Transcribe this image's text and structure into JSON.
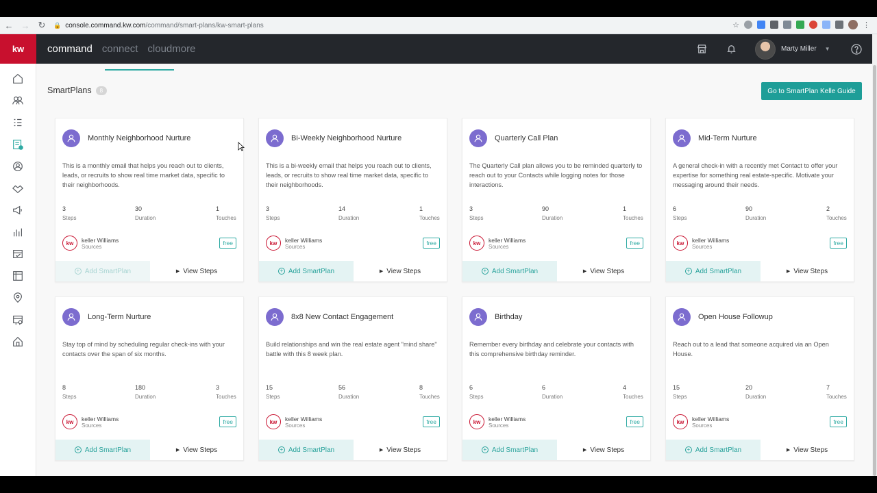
{
  "browser": {
    "url_host": "console.command.kw.com",
    "url_path": "/command/smart-plans/kw-smart-plans"
  },
  "header": {
    "logo": "kw",
    "nav": [
      "command",
      "connect",
      "cloudmore"
    ],
    "user_name": "Marty Miller"
  },
  "page": {
    "title": "SmartPlans",
    "count": "8",
    "guide_button": "Go to SmartPlan Kelle Guide"
  },
  "labels": {
    "steps": "Steps",
    "duration": "Duration",
    "touches": "Touches",
    "source_sub": "Sources",
    "free": "free",
    "add": "Add SmartPlan",
    "view": "View Steps"
  },
  "cards": [
    {
      "title": "Monthly Neighborhood Nurture",
      "desc": "This is a monthly email that helps you reach out to clients, leads, or recruits to show real time market data, specific to their neighborhoods.",
      "steps": "3",
      "duration": "30",
      "touches": "1",
      "source": "keller Williams",
      "add_disabled": true
    },
    {
      "title": "Bi-Weekly Neighborhood Nurture",
      "desc": "This is a bi-weekly email that helps you reach out to clients, leads, or recruits to show real time market data, specific to their neighborhoods.",
      "steps": "3",
      "duration": "14",
      "touches": "1",
      "source": "keller Williams",
      "add_disabled": false
    },
    {
      "title": "Quarterly Call Plan",
      "desc": "The Quarterly Call plan allows you to be reminded quarterly to reach out to your Contacts while logging notes for those interactions.",
      "steps": "3",
      "duration": "90",
      "touches": "1",
      "source": "keller Williams",
      "add_disabled": false
    },
    {
      "title": "Mid-Term Nurture",
      "desc": "A general check-in with a recently met Contact to offer your expertise for something real estate-specific. Motivate your messaging around their needs.",
      "steps": "6",
      "duration": "90",
      "touches": "2",
      "source": "keller Williams",
      "add_disabled": false
    },
    {
      "title": "Long-Term Nurture",
      "desc": "Stay top of mind by scheduling regular check-ins with your contacts over the span of six months.",
      "steps": "8",
      "duration": "180",
      "touches": "3",
      "source": "keller Williams",
      "add_disabled": false
    },
    {
      "title": "8x8 New Contact Engagement",
      "desc": "Build relationships and win the real estate agent \"mind share\" battle with this 8 week plan.",
      "steps": "15",
      "duration": "56",
      "touches": "8",
      "source": "keller Williams",
      "add_disabled": false
    },
    {
      "title": "Birthday",
      "desc": "Remember every birthday and celebrate your contacts with this comprehensive birthday reminder.",
      "steps": "6",
      "duration": "6",
      "touches": "4",
      "source": "keller Williams",
      "add_disabled": false
    },
    {
      "title": "Open House Followup",
      "desc": "Reach out to a lead that someone acquired via an Open House.",
      "steps": "15",
      "duration": "20",
      "touches": "7",
      "source": "keller Williams",
      "add_disabled": false
    }
  ],
  "sidebar_icons": [
    "home-icon",
    "contacts-icon",
    "tasks-icon",
    "smartplans-icon",
    "location-icon",
    "handshake-icon",
    "megaphone-icon",
    "reports-icon",
    "marketing-icon",
    "listings-icon",
    "map-pin-icon",
    "calendar-icon",
    "house-icon"
  ],
  "colors": {
    "brand_red": "#c8102e",
    "teal": "#1e9e98",
    "purple": "#7c6ccf",
    "header_bg": "#24272c"
  }
}
